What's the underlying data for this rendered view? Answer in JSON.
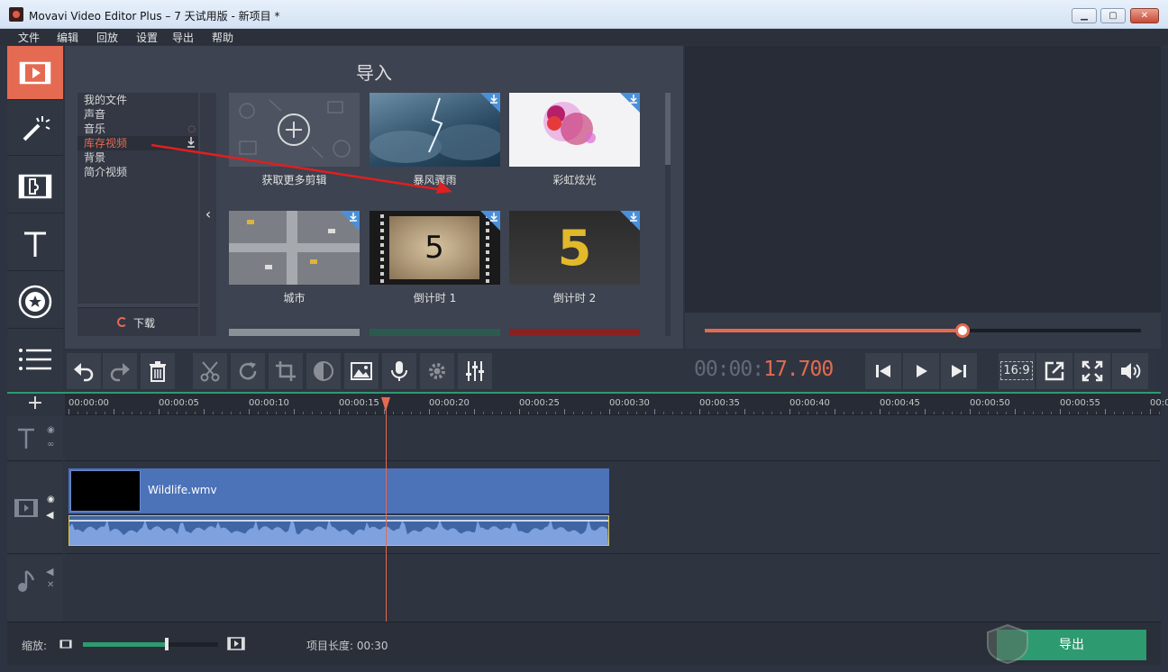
{
  "window": {
    "title": "Movavi Video Editor Plus – 7 天试用版 - 新项目 *"
  },
  "menu": [
    "文件",
    "编辑",
    "回放",
    "设置",
    "导出",
    "帮助"
  ],
  "import_panel": {
    "title": "导入",
    "categories": [
      {
        "label": "我的文件"
      },
      {
        "label": "声音"
      },
      {
        "label": "音乐"
      },
      {
        "label": "库存视频"
      },
      {
        "label": "背景"
      },
      {
        "label": "简介视频"
      }
    ],
    "download_label": "下载",
    "tiles": [
      {
        "label": "获取更多剪辑"
      },
      {
        "label": "暴风骤雨"
      },
      {
        "label": "彩虹炫光"
      },
      {
        "label": "城市"
      },
      {
        "label": "倒计时 1",
        "number": "5"
      },
      {
        "label": "倒计时 2",
        "number": "5"
      }
    ]
  },
  "player": {
    "timecode_prefix": "00:00:",
    "timecode_value": "17.700",
    "ratio": "16:9",
    "progress": 0.59
  },
  "timeline": {
    "ruler": [
      "00:00:00",
      "00:00:05",
      "00:00:10",
      "00:00:15",
      "00:00:20",
      "00:00:25",
      "00:00:30",
      "00:00:35",
      "00:00:40",
      "00:00:45",
      "00:00:50",
      "00:00:55",
      "00:0"
    ],
    "clip_name": "Wildlife.wmv"
  },
  "bottom": {
    "zoom_label": "缩放:",
    "zoom_level": 0.62,
    "project_length_label": "项目长度:",
    "project_length": "00:30",
    "export_label": "导出"
  },
  "colors": {
    "accent": "#e56a52",
    "green": "#2e9a6f",
    "clip_blue": "#4c72b8"
  }
}
